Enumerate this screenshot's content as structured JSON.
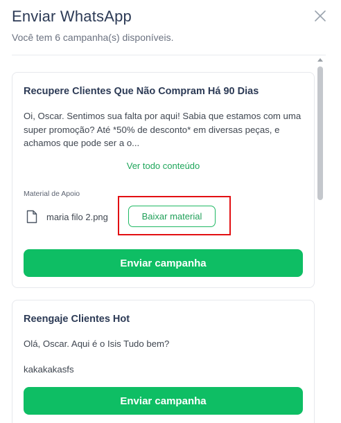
{
  "header": {
    "title": "Enviar WhatsApp",
    "subtitle": "Você tem 6 campanha(s) disponíveis.",
    "close_icon": "close-icon"
  },
  "campaigns": [
    {
      "title": "Recupere Clientes Que Não Compram Há 90 Dias",
      "message": "Oi,  Oscar. Sentimos sua falta por aqui! Sabia que estamos com uma super promoção? Até *50% de desconto* em diversas peças, e achamos que pode ser a o...",
      "see_all_label": "Ver todo conteúdo",
      "support_label": "Material de Apoio",
      "file_name": "maria filo 2.png",
      "download_label": "Baixar material",
      "send_label": "Enviar campanha"
    },
    {
      "title": "Reengaje Clientes Hot",
      "message": "Olá,  Oscar. Aqui é o  Isis Tudo bem?",
      "extra_line": "kakakakasfs",
      "send_label": "Enviar campanha"
    }
  ],
  "colors": {
    "primary_green": "#0ebe64",
    "link_green": "#1ea65a",
    "highlight_red": "#e20f12",
    "title_color": "#2c3a55"
  },
  "icons": {
    "file": "file-icon",
    "close": "close-icon",
    "scroll_up": "scroll-up-arrow-icon"
  }
}
